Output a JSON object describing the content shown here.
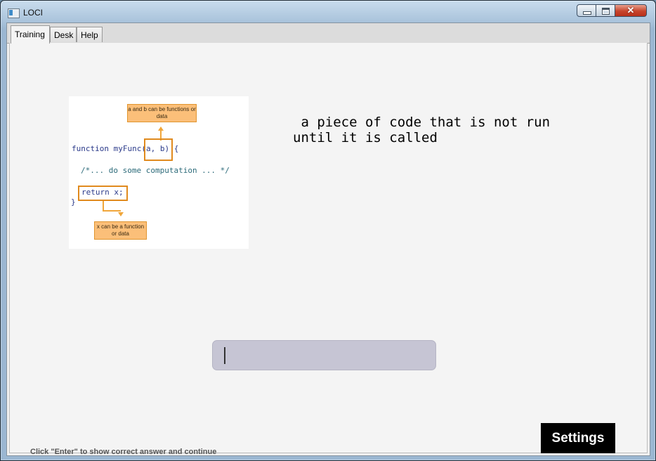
{
  "window": {
    "title": "LOCI",
    "close_glyph": "✕"
  },
  "tabs": [
    {
      "label": "Training",
      "active": true
    },
    {
      "label": "Desk",
      "active": false
    },
    {
      "label": "Help",
      "active": false
    }
  ],
  "figure": {
    "note_top": "a and b can be functions or data",
    "note_bottom": "x can be a function or data",
    "code_line1": "function myFunc(a, b) {",
    "code_line2": "/*... do some computation ... */",
    "code_line3": "return x;",
    "code_line4": "}"
  },
  "definition": " a piece of code that is not run\nuntil it is called",
  "answer": {
    "value": "",
    "placeholder": ""
  },
  "hint": "Click \"Enter\" to show correct answer and continue",
  "settings_label": "Settings",
  "icons": [
    "app-icon",
    "minimize-icon",
    "maximize-icon",
    "close-icon"
  ]
}
